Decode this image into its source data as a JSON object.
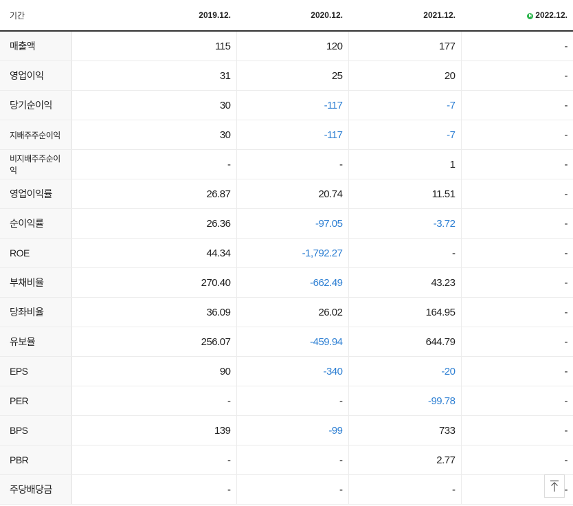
{
  "header": {
    "label": "기간",
    "periods": [
      "2019.12.",
      "2020.12.",
      "2021.12.",
      "2022.12."
    ],
    "estimate_mark": "E"
  },
  "rows": [
    {
      "label": "매출액",
      "values": [
        "115",
        "120",
        "177",
        "-"
      ]
    },
    {
      "label": "영업이익",
      "values": [
        "31",
        "25",
        "20",
        "-"
      ]
    },
    {
      "label": "당기순이익",
      "values": [
        "30",
        "-117",
        "-7",
        "-"
      ]
    },
    {
      "label": "지배주주순이익",
      "values": [
        "30",
        "-117",
        "-7",
        "-"
      ]
    },
    {
      "label": "비지배주주순이익",
      "values": [
        "-",
        "-",
        "1",
        "-"
      ]
    },
    {
      "label": "영업이익률",
      "values": [
        "26.87",
        "20.74",
        "11.51",
        "-"
      ]
    },
    {
      "label": "순이익률",
      "values": [
        "26.36",
        "-97.05",
        "-3.72",
        "-"
      ]
    },
    {
      "label": "ROE",
      "values": [
        "44.34",
        "-1,792.27",
        "-",
        "-"
      ]
    },
    {
      "label": "부채비율",
      "values": [
        "270.40",
        "-662.49",
        "43.23",
        "-"
      ]
    },
    {
      "label": "당좌비율",
      "values": [
        "36.09",
        "26.02",
        "164.95",
        "-"
      ]
    },
    {
      "label": "유보율",
      "values": [
        "256.07",
        "-459.94",
        "644.79",
        "-"
      ]
    },
    {
      "label": "EPS",
      "values": [
        "90",
        "-340",
        "-20",
        "-"
      ]
    },
    {
      "label": "PER",
      "values": [
        "-",
        "-",
        "-99.78",
        "-"
      ]
    },
    {
      "label": "BPS",
      "values": [
        "139",
        "-99",
        "733",
        "-"
      ]
    },
    {
      "label": "PBR",
      "values": [
        "-",
        "-",
        "2.77",
        "-"
      ]
    },
    {
      "label": "주당배당금",
      "values": [
        "-",
        "-",
        "-",
        "-"
      ]
    }
  ],
  "colors": {
    "negative": "#2d7fd3",
    "estimate": "#28b44a"
  },
  "icons": {
    "scroll_top": "arrow-up-to-line-icon"
  }
}
